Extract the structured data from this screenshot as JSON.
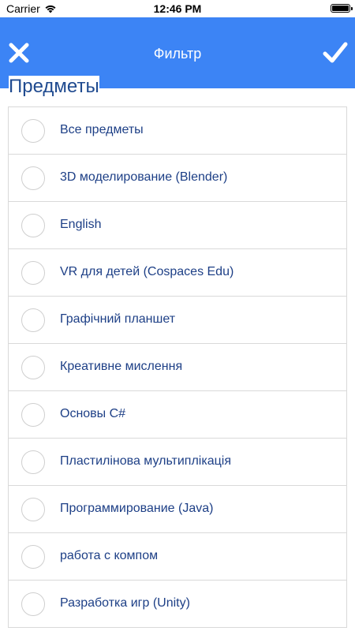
{
  "status_bar": {
    "carrier": "Carrier",
    "time": "12:46 PM"
  },
  "nav_bar": {
    "title": "Фильтр",
    "close_icon": "close-icon",
    "confirm_icon": "checkmark-icon",
    "background": "#3c84f5"
  },
  "section": {
    "title": "Предметы"
  },
  "subjects": [
    {
      "label": "Все предметы",
      "selected": false
    },
    {
      "label": "3D моделирование (Blender)",
      "selected": false
    },
    {
      "label": "English",
      "selected": false
    },
    {
      "label": "VR для детей (Cospaces Edu)",
      "selected": false
    },
    {
      "label": "Графічний планшет",
      "selected": false
    },
    {
      "label": "Креативне мислення",
      "selected": false
    },
    {
      "label": "Основы C#",
      "selected": false
    },
    {
      "label": "Пластилінова мультиплікація",
      "selected": false
    },
    {
      "label": "Программирование (Java)",
      "selected": false
    },
    {
      "label": "работа с компом",
      "selected": false
    },
    {
      "label": "Разработка игр (Unity)",
      "selected": false
    }
  ],
  "colors": {
    "accent": "#3c84f5",
    "label_text": "#1d3f86",
    "section_title": "#1f4a8f"
  }
}
